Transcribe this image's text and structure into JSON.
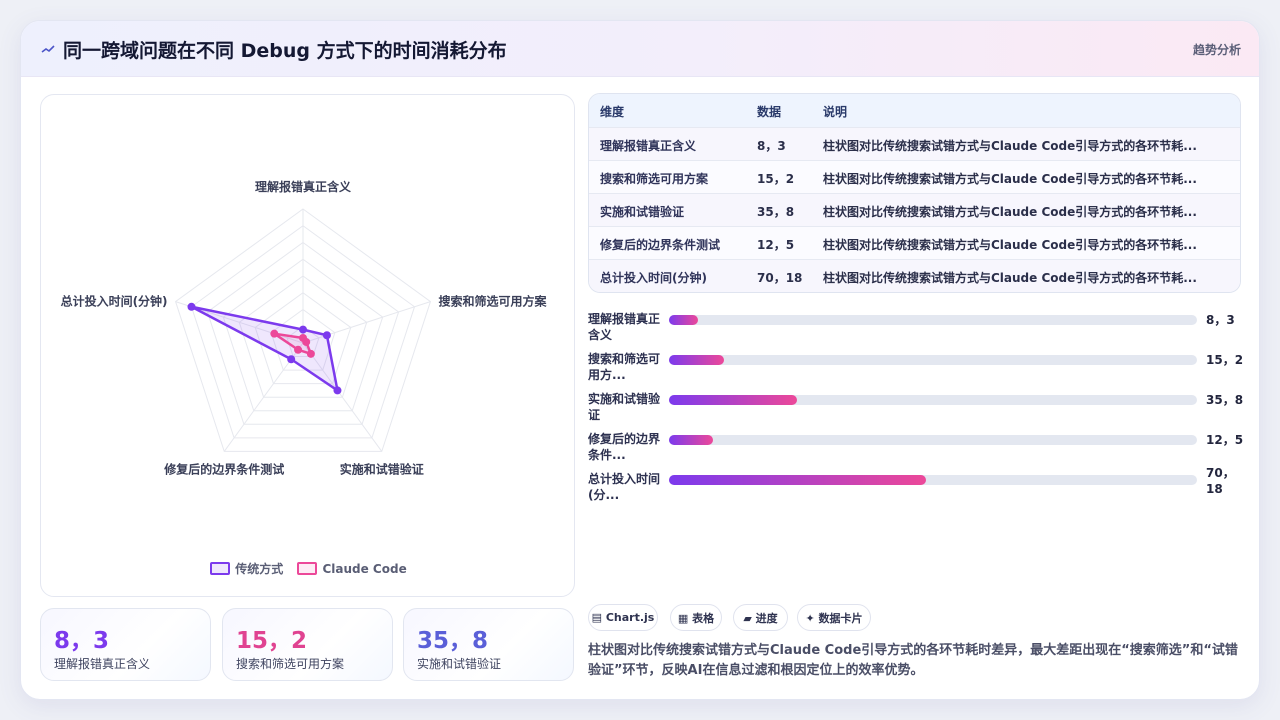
{
  "header": {
    "title": "同一跨域问题在不同 Debug 方式下的时间消耗分布",
    "right_label": "趋势分析"
  },
  "chart_data": {
    "type": "radar",
    "axes": [
      "理解报错真正含义",
      "搜索和筛选可用方案",
      "实施和试错验证",
      "修复后的边界条件测试",
      "总计投入时间(分钟)"
    ],
    "series": [
      {
        "name": "传统方式",
        "values": [
          8,
          15,
          35,
          12,
          70
        ],
        "color": "#7c3aed"
      },
      {
        "name": "Claude Code",
        "values": [
          3,
          2,
          8,
          5,
          18
        ],
        "color": "#ec4899"
      }
    ],
    "rmax": 80,
    "levels": 8,
    "legend_position": "bottom"
  },
  "table": {
    "headers": [
      "维度",
      "数据",
      "说明"
    ],
    "rows": [
      {
        "dim": "理解报错真正含义",
        "data": "8，3",
        "note": "柱状图对比传统搜索试错方式与Claude Code引导方式的各环节耗..."
      },
      {
        "dim": "搜索和筛选可用方案",
        "data": "15，2",
        "note": "柱状图对比传统搜索试错方式与Claude Code引导方式的各环节耗..."
      },
      {
        "dim": "实施和试错验证",
        "data": "35，8",
        "note": "柱状图对比传统搜索试错方式与Claude Code引导方式的各环节耗..."
      },
      {
        "dim": "修复后的边界条件测试",
        "data": "12，5",
        "note": "柱状图对比传统搜索试错方式与Claude Code引导方式的各环节耗..."
      },
      {
        "dim": "总计投入时间(分钟)",
        "data": "70，18",
        "note": "柱状图对比传统搜索试错方式与Claude Code引导方式的各环节耗..."
      }
    ]
  },
  "progress": {
    "scale_max": 144,
    "rows": [
      {
        "label": "理解报错真正含义",
        "value_text": "8，3",
        "value": 8
      },
      {
        "label": "搜索和筛选可用方...",
        "value_text": "15，2",
        "value": 15
      },
      {
        "label": "实施和试错验证",
        "value_text": "35，8",
        "value": 35
      },
      {
        "label": "修复后的边界条件...",
        "value_text": "12，5",
        "value": 12
      },
      {
        "label": "总计投入时间(分...",
        "value_text": "70，18",
        "value": 70
      }
    ]
  },
  "stats": [
    {
      "value": "8，3",
      "label": "理解报错真正含义",
      "color": "#7c3aed"
    },
    {
      "value": "15，2",
      "label": "搜索和筛选可用方案",
      "color": "#e04391"
    },
    {
      "value": "35，8",
      "label": "实施和试错验证",
      "color": "#5a5fd8"
    }
  ],
  "tags": [
    "▤ Chart.js",
    "▦ 表格",
    "▰ 进度",
    "✦ 数据卡片"
  ],
  "description": "柱状图对比传统搜索试错方式与Claude Code引导方式的各环节耗时差异，最大差距出现在“搜索筛选”和“试错验证”环节，反映AI在信息过滤和根因定位上的效率优势。"
}
